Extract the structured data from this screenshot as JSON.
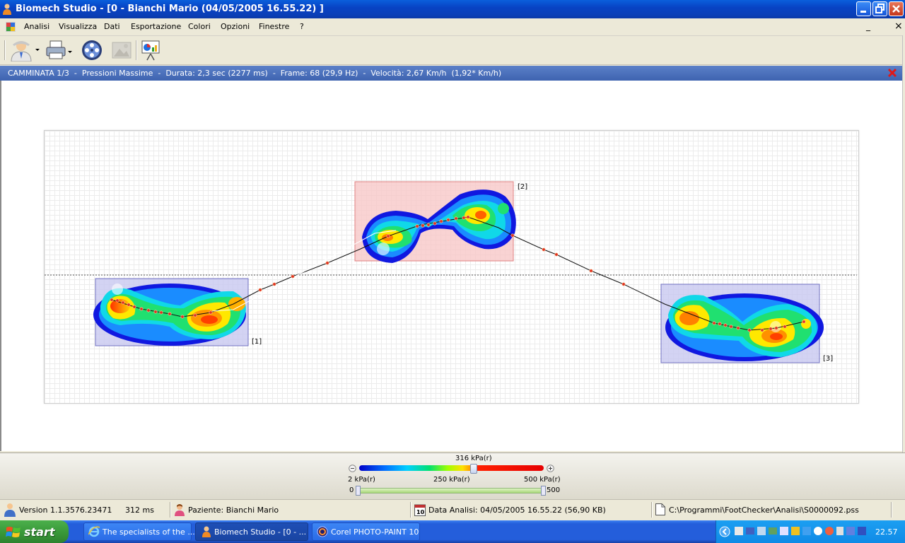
{
  "window": {
    "title": "Biomech Studio - [0 -  Bianchi Mario  (04/05/2005 16.55.22) ]",
    "buttons": [
      "minimize",
      "restore",
      "close"
    ]
  },
  "menubar": {
    "items": [
      "Analisi",
      "Visualizza",
      "Dati",
      "Esportazione",
      "Colori",
      "Opzioni",
      "Finestre",
      "?"
    ],
    "mdi_buttons": [
      "_",
      "restore",
      "×"
    ]
  },
  "toolbar": {
    "items": [
      {
        "icon": "patient-icon",
        "dropdown": true
      },
      {
        "icon": "printer-icon",
        "dropdown": true
      },
      {
        "icon": "film-reel-icon",
        "dropdown": false
      },
      {
        "icon": "image-icon",
        "dropdown": false,
        "disabled": true
      },
      {
        "icon": "presentation-chart-icon",
        "dropdown": false
      }
    ]
  },
  "infobar": {
    "text": "CAMMINATA 1/3  -  Pressioni Massime  -  Durata: 2,3 sec (2277 ms)  -  Frame: 68 (29,9 Hz)  -  Velocità: 2,67 Km/h  (1,92* Km/h)",
    "close_icon": "red-x-icon"
  },
  "footprints": [
    {
      "label": "[1]"
    },
    {
      "label": "[2]"
    },
    {
      "label": "[3]"
    }
  ],
  "scale": {
    "current_value": "316 kPa(r)",
    "min_label": "2 kPa(r)",
    "mid_label": "250 kPa(r)",
    "max_label": "500 kPa(r)",
    "range_min": "0",
    "range_max": "500",
    "current_fraction": 0.63
  },
  "statusbar": {
    "version": "Version 1.1.3576.23471",
    "time": "312 ms",
    "patient": "Paziente: Bianchi  Mario",
    "date": "Data Analisi: 04/05/2005 16.55.22  (56,90 KB)",
    "path": "C:\\Programmi\\FootChecker\\Analisi\\S0000092.pss"
  },
  "taskbar": {
    "start_label": "start",
    "tasks": [
      {
        "label": "The specialists of the ...",
        "icon": "internet-explorer-icon",
        "active": false
      },
      {
        "label": "Biomech Studio - [0 - ...",
        "icon": "biomech-icon",
        "active": true
      },
      {
        "label": "Corel PHOTO-PAINT 10",
        "icon": "corel-icon",
        "active": false
      }
    ],
    "clock": "22.57"
  },
  "colors": {
    "titlebar": "#0a4fd0",
    "infobar": "#4a70bc",
    "footprint_box_1": "#c8c8f0",
    "footprint_box_2": "#f8c8c8",
    "footprint_box_3": "#c8c8f0",
    "trajectory_point": "#e03020"
  }
}
